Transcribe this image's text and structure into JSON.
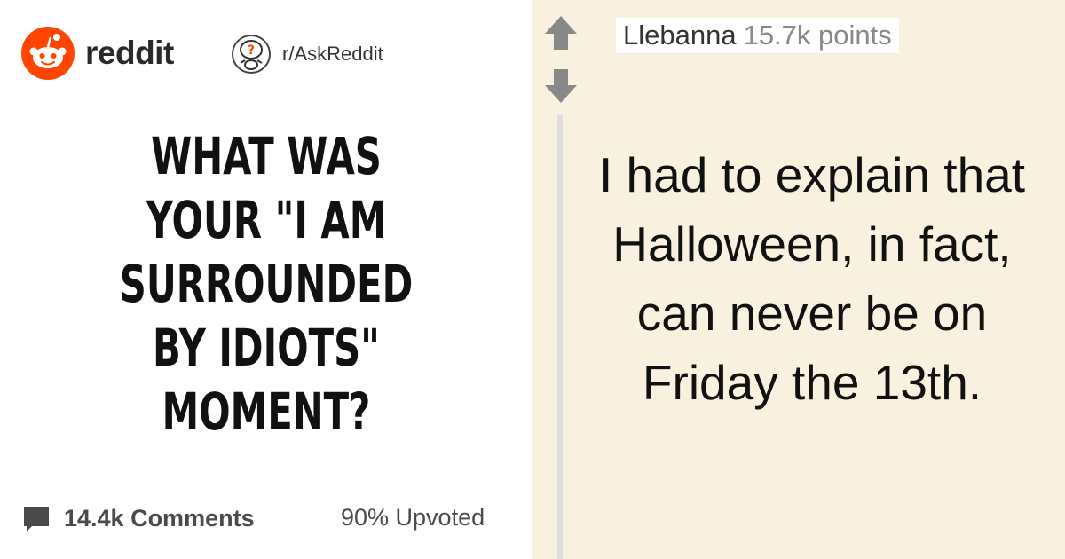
{
  "header": {
    "brand": "reddit",
    "subreddit": "r/AskReddit"
  },
  "post": {
    "title": "WHAT WAS YOUR \"I AM SURROUNDED BY IDIOTS\" MOMENT?",
    "comments_label": "14.4k Comments",
    "upvoted_label": "90% Upvoted"
  },
  "comment": {
    "author": "Llebanna",
    "points": "15.7k points",
    "text": "I had to explain that Halloween, in fact, can never be on Friday the 13th."
  },
  "icons": {
    "brand_logo": "reddit-alien-logo",
    "subreddit_icon": "askreddit-snoo-question-icon",
    "comments_icon": "speech-bubble-icon",
    "upvote_icon": "arrow-up-icon",
    "downvote_icon": "arrow-down-icon"
  },
  "colors": {
    "brand_orange": "#ff4500",
    "comment_background": "#f8f1e0",
    "icon_gray": "#888888"
  }
}
